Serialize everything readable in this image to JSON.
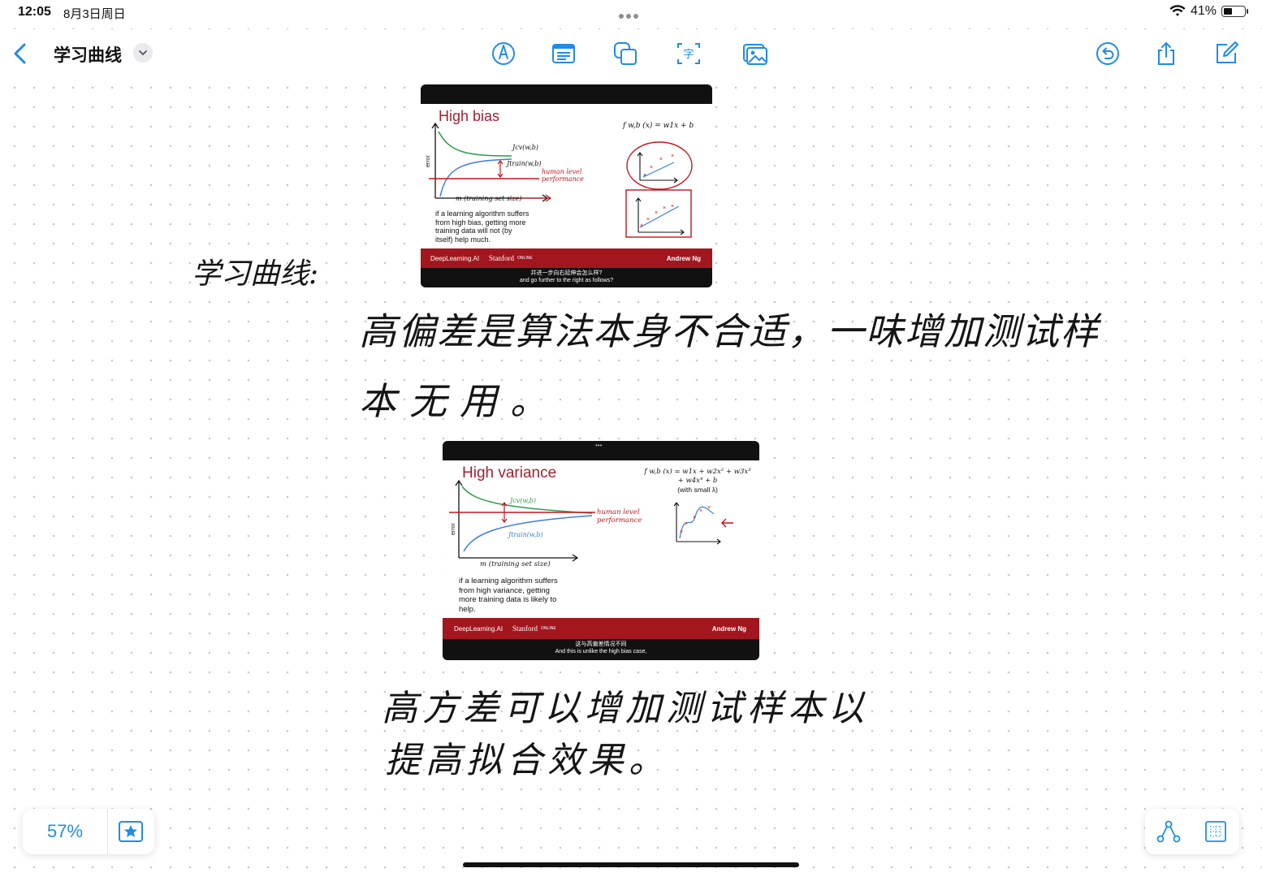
{
  "status": {
    "time": "12:05",
    "date": "8月3日周日",
    "battery": "41%",
    "battery_fraction": 0.41
  },
  "toolbar": {
    "title": "学习曲线",
    "icons": [
      "back-icon",
      "pen-icon",
      "text-box-icon",
      "shapes-icon",
      "text-recognition-icon",
      "media-icon",
      "undo-icon",
      "share-icon",
      "compose-icon"
    ]
  },
  "side_label": "学习曲线:",
  "slide1": {
    "title": "High bias",
    "formula": "f w,b (x) = w1x + b",
    "cv_label": "Jcv(w,b)",
    "train_label": "Jtrain(w,b)",
    "human_label_1": "human level",
    "human_label_2": "performance",
    "y_label": "error",
    "x_label": "m (training set size)",
    "body_lines": [
      "if a learning algorithm suffers",
      "from high bias, getting more",
      "training data will not (by",
      "itself) help much."
    ],
    "footer_brand": "DeepLearning.AI",
    "footer_stanford": "Stanford",
    "footer_online": "ONLINE",
    "footer_author": "Andrew Ng",
    "caption_cn": "并进一步向右延伸会怎么样?",
    "caption_en": "and go further to the right as follows?"
  },
  "note1": {
    "line1": "高偏差是算法本身不合适，一味增加测试样",
    "line2": "本无用。"
  },
  "slide2": {
    "title": "High variance",
    "formula_1": "f w,b (x) = w1x + w2x² + w3x³",
    "formula_2": "+ w4x⁴ + b",
    "formula_3": "(with small λ)",
    "cv_label": "Jcv(w,b)",
    "train_label": "Jtrain(w,b)",
    "human_label_1": "human level",
    "human_label_2": "performance",
    "y_label": "error",
    "x_label": "m (training set size)",
    "body_lines": [
      "if a learning algorithm suffers",
      "from high variance, getting",
      "more training data is likely to",
      "help."
    ],
    "footer_brand": "DeepLearning.AI",
    "footer_stanford": "Stanford",
    "footer_online": "ONLINE",
    "footer_author": "Andrew Ng",
    "caption_cn": "这与高偏差情况不同",
    "caption_en": "And this is unlike the high bias case,"
  },
  "note2": {
    "line1": "高方差可以增加测试样本以",
    "line2": "提高拟合效果。"
  },
  "bottom": {
    "zoom": "57%"
  },
  "colors": {
    "accent": "#1f8ce6",
    "slide_red": "#a3161e",
    "cv_green": "#2a9d4a",
    "train_blue": "#3d7fd9"
  }
}
